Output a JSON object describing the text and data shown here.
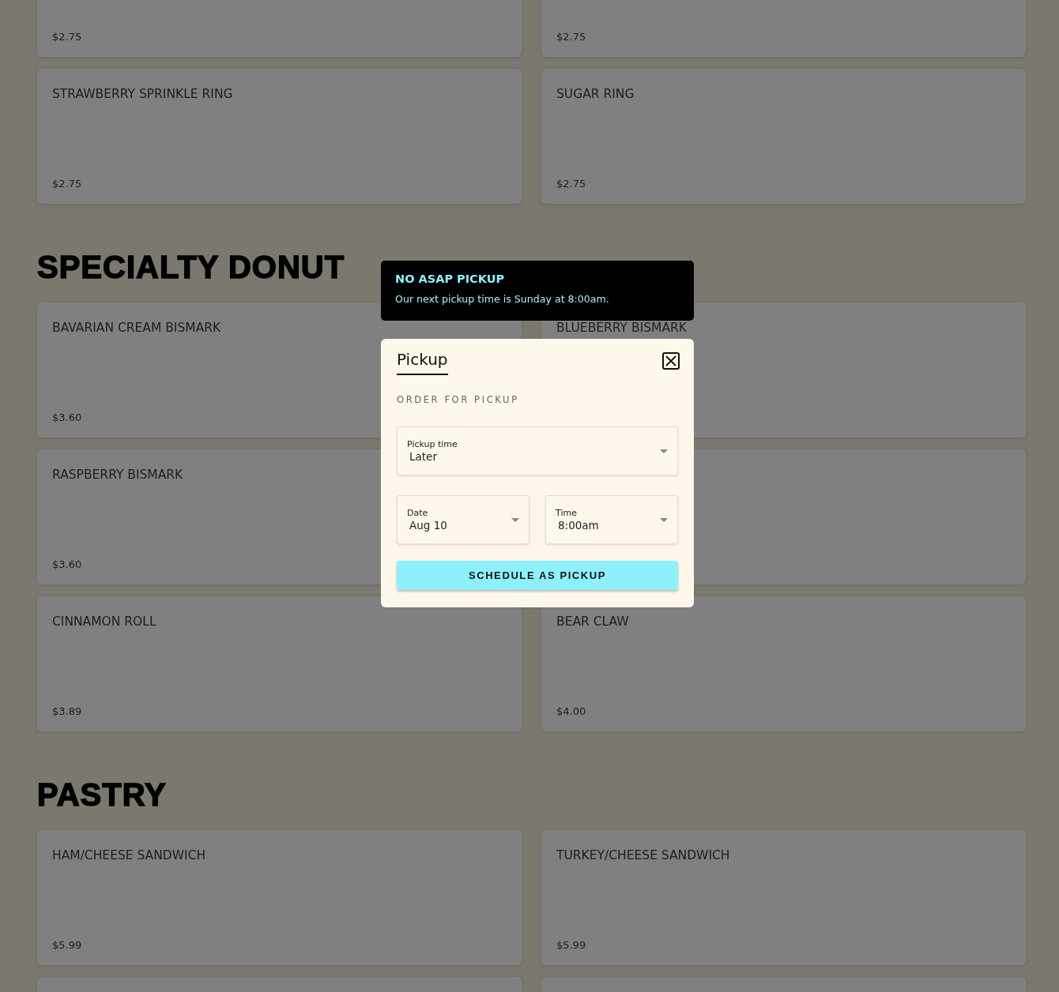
{
  "sections": [
    {
      "items": [
        {
          "kind": "partial",
          "price": "$2.75"
        },
        {
          "kind": "partial",
          "price": "$2.75"
        },
        {
          "kind": "full",
          "name": "STRAWBERRY SPRINKLE RING",
          "price": "$2.75"
        },
        {
          "kind": "full",
          "name": "SUGAR RING",
          "price": "$2.75"
        }
      ]
    },
    {
      "title": "SPECIALTY DONUT",
      "items": [
        {
          "kind": "full",
          "name": "BAVARIAN CREAM BISMARK",
          "price": "$3.60"
        },
        {
          "kind": "full",
          "name": "BLUEBERRY BISMARK"
        },
        {
          "kind": "full",
          "name": "RASPBERRY BISMARK",
          "price": "$3.60"
        },
        {
          "kind": "full"
        },
        {
          "kind": "full",
          "name": "CINNAMON ROLL",
          "price": "$3.89"
        },
        {
          "kind": "full",
          "name": "BEAR CLAW",
          "price": "$4.00"
        }
      ]
    },
    {
      "title": "PASTRY",
      "items": [
        {
          "kind": "full",
          "name": "HAM/CHEESE SANDWICH",
          "price": "$5.99"
        },
        {
          "kind": "full",
          "name": "TURKEY/CHEESE SANDWICH",
          "price": "$5.99"
        },
        {
          "kind": "full"
        },
        {
          "kind": "full"
        }
      ]
    }
  ],
  "toast": {
    "title": "NO ASAP PICKUP",
    "message": "Our next pickup time is Sunday at 8:00am."
  },
  "dialog": {
    "title": "Pickup",
    "subtitle": "ORDER FOR PICKUP",
    "pickup_time": {
      "label": "Pickup time",
      "value": "Later"
    },
    "date": {
      "label": "Date",
      "value": "Aug 10"
    },
    "time": {
      "label": "Time",
      "value": "8:00am"
    },
    "button": "SCHEDULE AS PICKUP"
  }
}
